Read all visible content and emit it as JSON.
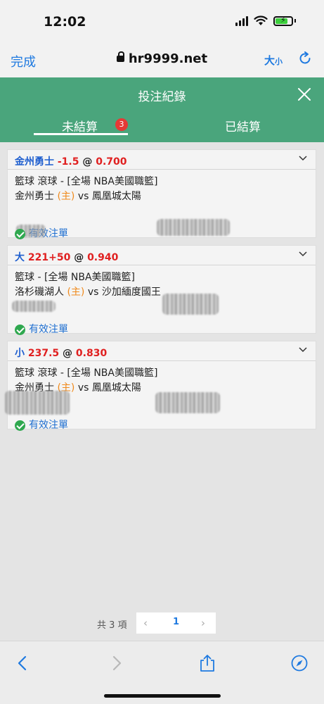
{
  "status_bar": {
    "time": "12:02"
  },
  "browser": {
    "done_label": "完成",
    "url": "hr9999.net",
    "text_size_big": "大",
    "text_size_small": "小"
  },
  "header": {
    "title": "投注紀錄"
  },
  "tabs": [
    {
      "label": "未結算",
      "badge": "3",
      "active": true
    },
    {
      "label": "已結算",
      "active": false
    }
  ],
  "bets": [
    {
      "selection": "金州勇士",
      "line": "-1.5",
      "at": "@",
      "odds": "0.700",
      "league": "籃球 滾球 - [全場 NBA美國職籃]",
      "home_team": "金州勇士",
      "home_tag": "(主)",
      "vs": "vs",
      "away_team": "鳳凰城太陽",
      "status": "有效注單"
    },
    {
      "selection": "大",
      "line": "221+50",
      "at": "@",
      "odds": "0.940",
      "league": "籃球 - [全場 NBA美國職籃]",
      "home_team": "洛杉磯湖人",
      "home_tag": "(主)",
      "vs": "vs",
      "away_team": "沙加緬度國王",
      "status": "有效注單"
    },
    {
      "selection": "小",
      "line": "237.5",
      "at": "@",
      "odds": "0.830",
      "league": "籃球 滾球 - [全場 NBA美國職籃]",
      "home_team": "金州勇士",
      "home_tag": "(主)",
      "vs": "vs",
      "away_team": "鳳凰城太陽",
      "status": "有效注單"
    }
  ],
  "pager": {
    "total": "共 3 項",
    "prev": "‹",
    "page": "1",
    "next": "›"
  },
  "colors": {
    "header_green": "#4aa57c",
    "odds_red": "#e02020",
    "team_blue": "#1f5fcf",
    "link_blue": "#1f7ae0"
  }
}
